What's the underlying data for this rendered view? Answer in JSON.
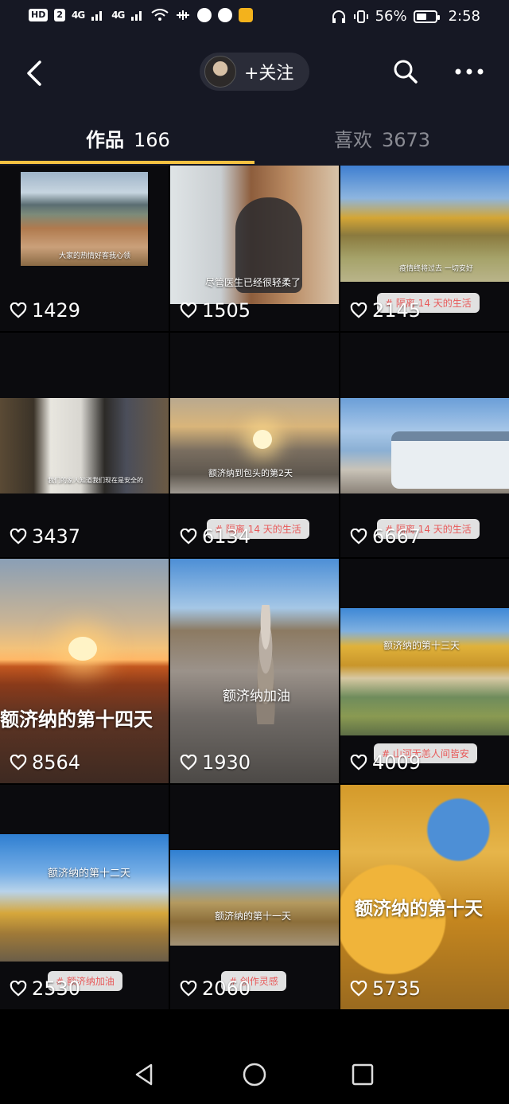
{
  "status_bar": {
    "hd_badge": "HD",
    "sim": "2",
    "net1": "4G",
    "net2": "4G",
    "battery_percent": "56%",
    "battery_level": 0.56,
    "time": "2:58"
  },
  "header": {
    "follow_label": "+关注",
    "icons": [
      "back-arrow-icon",
      "search-icon",
      "more-icon"
    ]
  },
  "tabs": [
    {
      "label": "作品",
      "count": "166"
    },
    {
      "label": "喜欢",
      "count": "3673"
    }
  ],
  "videos": [
    {
      "likes": "1429",
      "caption": "大家的热情好客我心领"
    },
    {
      "likes": "1505",
      "caption": "尽管医生已经很轻柔了"
    },
    {
      "likes": "2145",
      "tag": "# 隔离 14 天的生活",
      "caption": "疫情终将过去 一切安好"
    },
    {
      "likes": "3437",
      "caption": "我们的家人知道我们现在是安全的"
    },
    {
      "likes": "6134",
      "tag": "# 隔离 14 天的生活",
      "title": "额济纳到包头的第2天"
    },
    {
      "likes": "6667",
      "tag": "# 隔离 14 天的生活"
    },
    {
      "likes": "8564",
      "title": "额济纳的第十四天"
    },
    {
      "likes": "1930",
      "title": "额济纳加油"
    },
    {
      "likes": "4009",
      "tag": "# 山河无恙人间皆安",
      "title": "额济纳的第十三天"
    },
    {
      "likes": "2530",
      "tag": "# 额济纳加油",
      "title": "额济纳的第十二天"
    },
    {
      "likes": "2060",
      "tag": "# 创作灵感",
      "title": "额济纳的第十一天"
    },
    {
      "likes": "5735",
      "title": "额济纳的第十天"
    }
  ],
  "colors": {
    "background": "#161824",
    "tab_indicator": "#f5c242",
    "tag_text": "#e85a5a"
  }
}
